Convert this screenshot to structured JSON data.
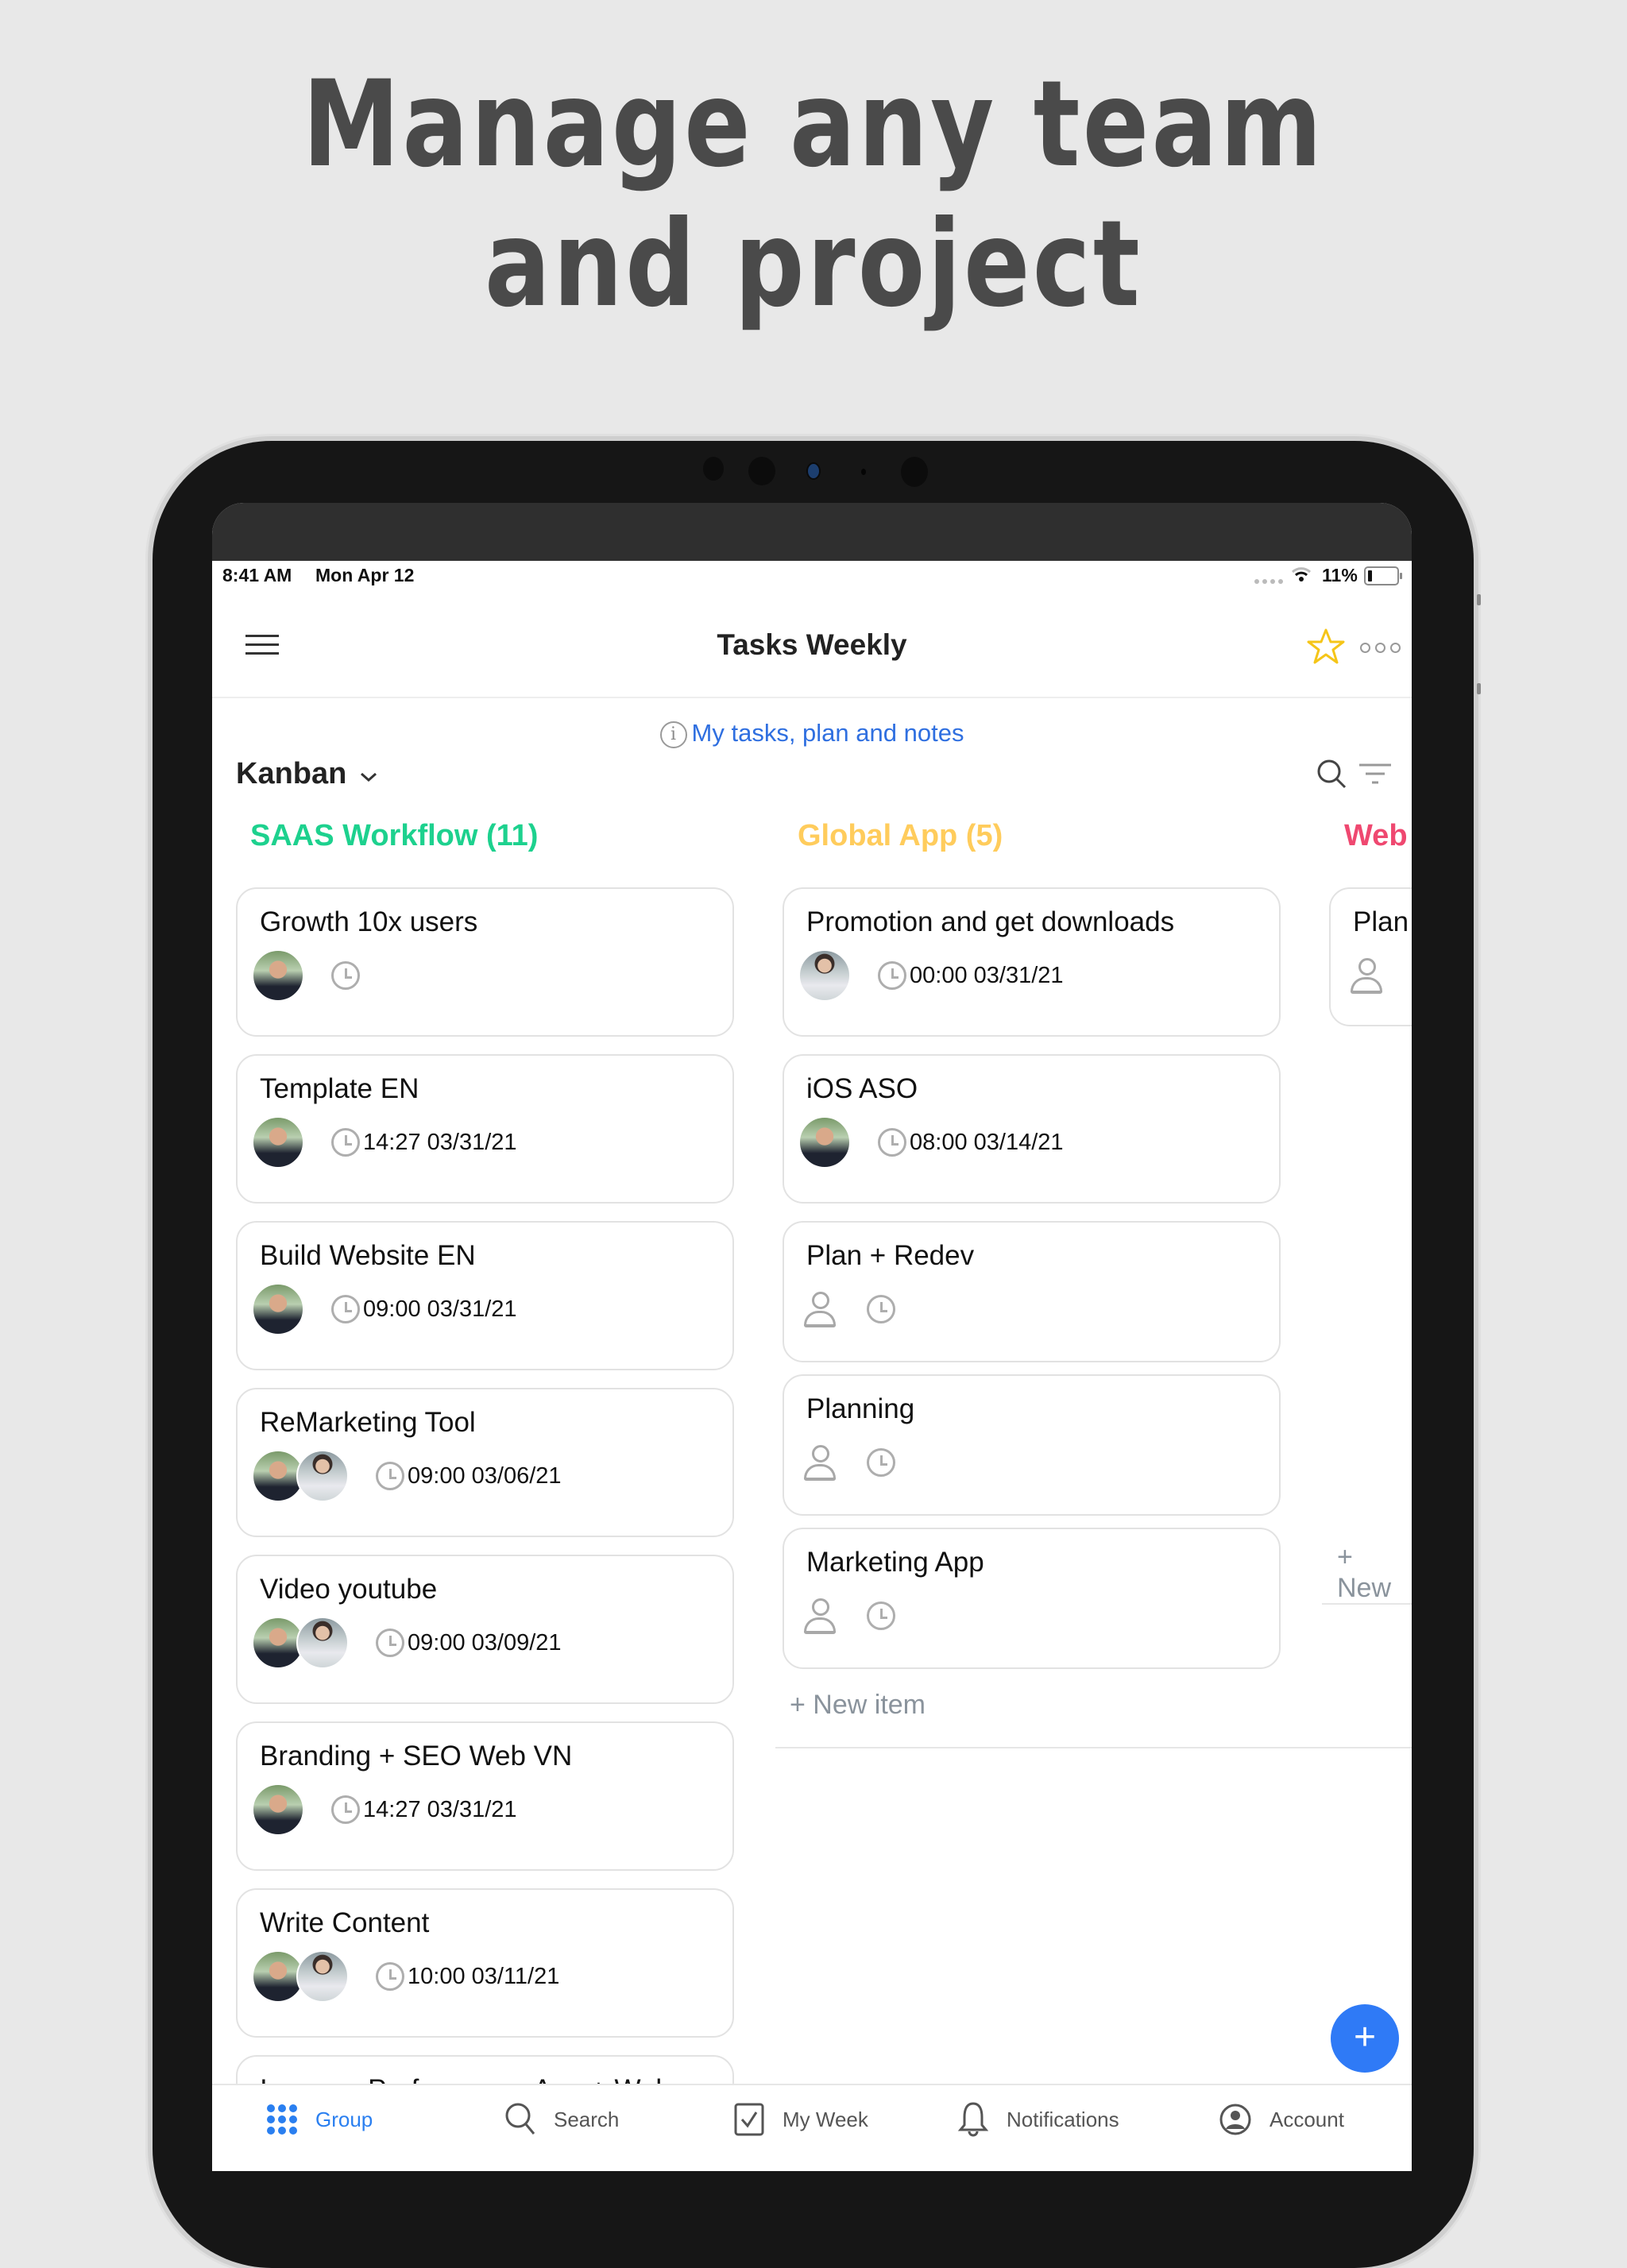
{
  "headline": {
    "line1": "Manage any team",
    "line2": "and project"
  },
  "status_bar": {
    "time": "8:41 AM",
    "date": "Mon Apr 12",
    "battery": "11%"
  },
  "navbar": {
    "title": "Tasks Weekly"
  },
  "info_link": {
    "label": "My tasks, plan and notes"
  },
  "view_selector": {
    "label": "Kanban"
  },
  "colors": {
    "accent": "#2f7af6",
    "link": "#2f6fe0",
    "column1": "#1dd18e",
    "column2": "#ffcc5c",
    "column3": "#ef4870",
    "star": "#f5c518"
  },
  "columns": [
    {
      "title": "SAAS Workflow (11)",
      "cards": [
        {
          "title": "Growth 10x users",
          "assignees": [
            "man"
          ],
          "due": ""
        },
        {
          "title": "Template EN",
          "assignees": [
            "man"
          ],
          "due": "14:27 03/31/21"
        },
        {
          "title": "Build Website EN",
          "assignees": [
            "man"
          ],
          "due": "09:00 03/31/21"
        },
        {
          "title": "ReMarketing Tool",
          "assignees": [
            "man",
            "woman"
          ],
          "due": "09:00 03/06/21"
        },
        {
          "title": "Video youtube",
          "assignees": [
            "man",
            "woman"
          ],
          "due": "09:00 03/09/21"
        },
        {
          "title": "Branding + SEO Web VN",
          "assignees": [
            "man"
          ],
          "due": "14:27 03/31/21"
        },
        {
          "title": "Write Content",
          "assignees": [
            "man",
            "woman"
          ],
          "due": "10:00 03/11/21"
        },
        {
          "title": "Improve Performance App + Web",
          "assignees": [],
          "due": ""
        }
      ]
    },
    {
      "title": "Global App (5)",
      "cards": [
        {
          "title": "Promotion and get downloads",
          "assignees": [
            "woman"
          ],
          "due": "00:00 03/31/21"
        },
        {
          "title": "iOS ASO",
          "assignees": [
            "man"
          ],
          "due": "08:00 03/14/21"
        },
        {
          "title": "Plan + Redev",
          "assignees": [],
          "due": ""
        },
        {
          "title": "Planning",
          "assignees": [],
          "due": ""
        },
        {
          "title": "Marketing App",
          "assignees": [],
          "due": ""
        }
      ],
      "new_item_label": "+ New item"
    },
    {
      "title": "Web",
      "cards": [
        {
          "title": "Plan",
          "assignees": [],
          "due": ""
        }
      ],
      "new_item_label": "+ New"
    }
  ],
  "fab": {
    "label": "+"
  },
  "bottom_nav": [
    {
      "label": "Group",
      "icon": "grid-icon",
      "active": true
    },
    {
      "label": "Search",
      "icon": "search-icon",
      "active": false
    },
    {
      "label": "My Week",
      "icon": "checkbox-icon",
      "active": false
    },
    {
      "label": "Notifications",
      "icon": "bell-icon",
      "active": false
    },
    {
      "label": "Account",
      "icon": "account-icon",
      "active": false
    }
  ]
}
